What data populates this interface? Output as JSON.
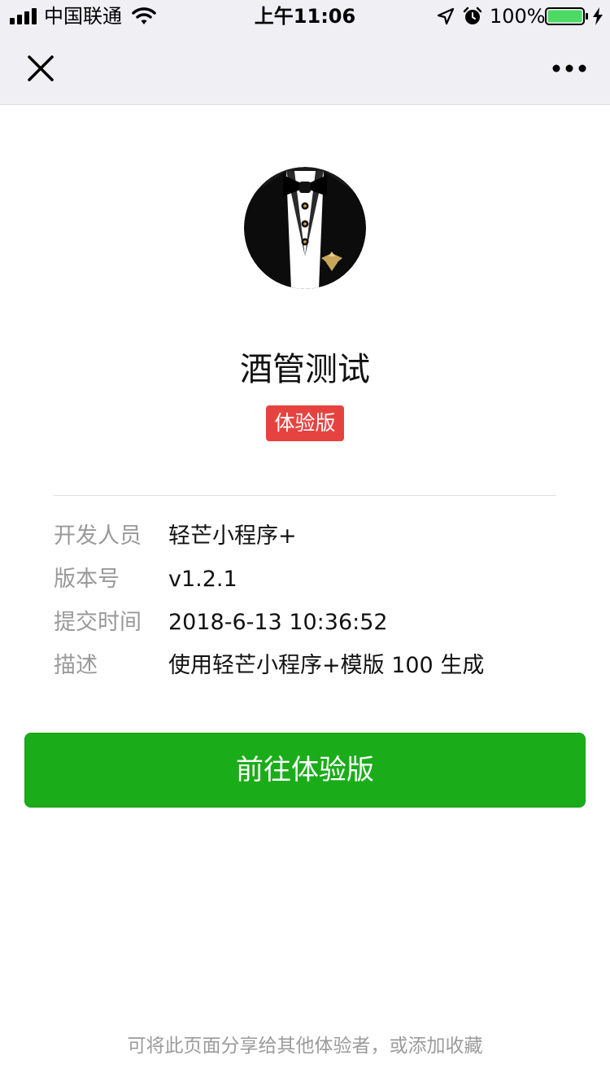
{
  "status_bar": {
    "carrier": "中国联通",
    "time": "上午11:06",
    "battery_percent": "100%",
    "battery_level": 1.0,
    "icons": [
      "signal-icon",
      "wifi-icon",
      "location-icon",
      "alarm-icon",
      "battery-icon",
      "charging-icon"
    ]
  },
  "nav": {
    "close_icon": "close-icon",
    "more_icon": "more-icon"
  },
  "app": {
    "name": "酒管测试",
    "badge": "体验版",
    "avatar_icon": "tuxedo-avatar"
  },
  "info": {
    "rows": [
      {
        "label": "开发人员",
        "value": "轻芒小程序+"
      },
      {
        "label": "版本号",
        "value": "v1.2.1"
      },
      {
        "label": "提交时间",
        "value": "2018-6-13 10:36:52"
      },
      {
        "label": "描述",
        "value": "使用轻芒小程序+模版 100 生成"
      }
    ]
  },
  "actions": {
    "primary_label": "前往体验版"
  },
  "footer": {
    "hint": "可将此页面分享给其他体验者，或添加收藏"
  },
  "colors": {
    "bar_background": "#efeff4",
    "badge_red": "#e64340",
    "button_green": "#1aad19",
    "battery_green": "#4cd964",
    "muted_text": "#999999"
  }
}
